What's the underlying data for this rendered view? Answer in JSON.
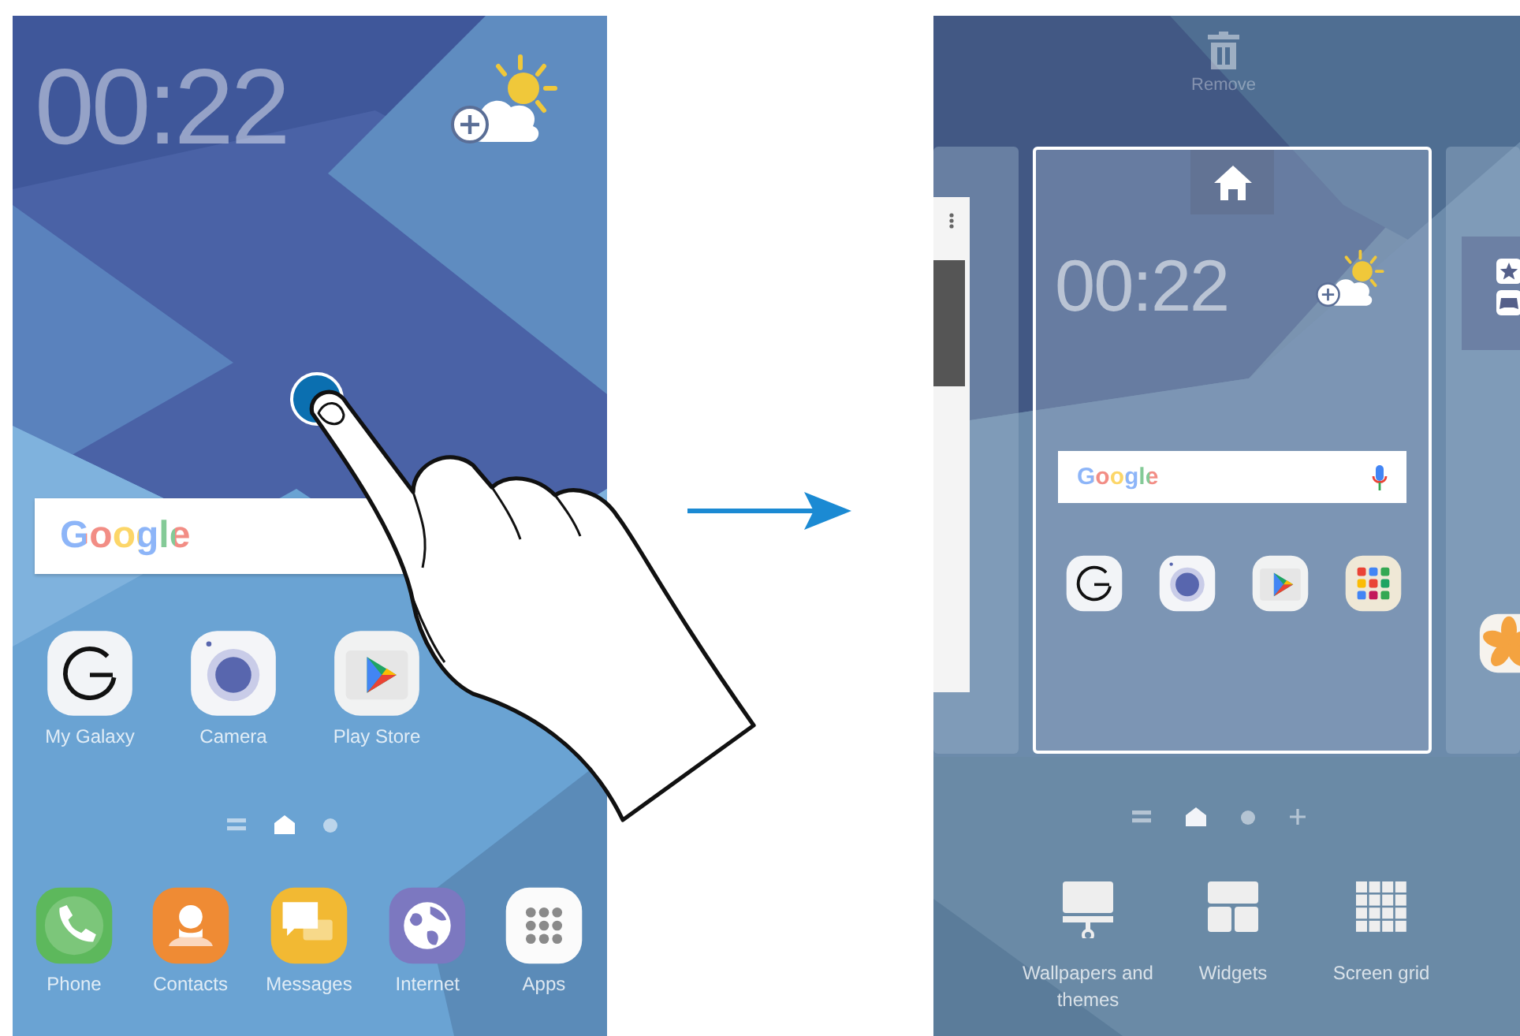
{
  "home_screen": {
    "clock": "00:22",
    "search_bar": {
      "logo": "Google"
    },
    "apps": [
      {
        "kind": "galaxy",
        "label": "My Galaxy"
      },
      {
        "kind": "camera",
        "label": "Camera"
      },
      {
        "kind": "play",
        "label": "Play Store"
      }
    ],
    "page_indicator": [
      {
        "kind": "menu",
        "selected": false
      },
      {
        "kind": "home",
        "selected": true
      },
      {
        "kind": "dot",
        "selected": false
      }
    ],
    "dock": [
      {
        "kind": "phone",
        "label": "Phone"
      },
      {
        "kind": "contacts",
        "label": "Contacts"
      },
      {
        "kind": "messages",
        "label": "Messages"
      },
      {
        "kind": "internet",
        "label": "Internet"
      },
      {
        "kind": "apps",
        "label": "Apps"
      }
    ]
  },
  "edit_screen": {
    "remove_label": "Remove",
    "clock": "00:22",
    "search_bar": {
      "logo": "Google"
    },
    "apps": [
      {
        "kind": "galaxy"
      },
      {
        "kind": "camera"
      },
      {
        "kind": "play"
      },
      {
        "kind": "folder"
      }
    ],
    "page_indicator": [
      {
        "kind": "menu",
        "selected": false
      },
      {
        "kind": "home",
        "selected": true
      },
      {
        "kind": "dot",
        "selected": false
      },
      {
        "kind": "add",
        "selected": false
      }
    ],
    "options": [
      {
        "kind": "wallpaper",
        "label": "Wallpapers and themes"
      },
      {
        "kind": "widgets",
        "label": "Widgets"
      },
      {
        "kind": "grid",
        "label": "Screen grid"
      }
    ]
  }
}
